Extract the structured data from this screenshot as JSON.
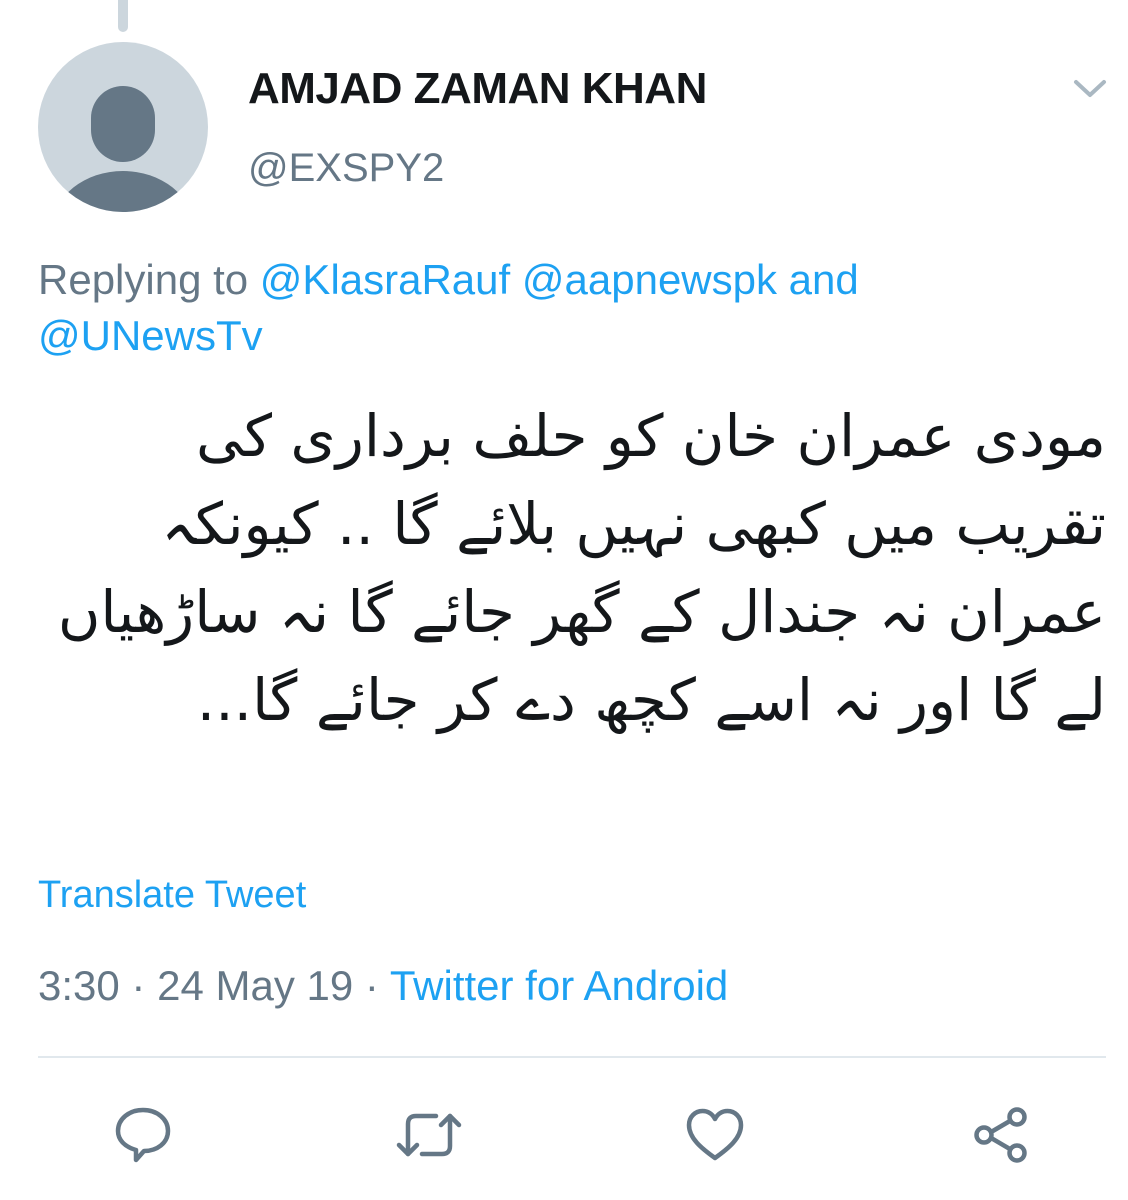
{
  "tweet": {
    "author": {
      "display_name": "AMJAD ZAMAN KHAN",
      "handle": "@EXSPY2",
      "avatar_icon": "default-avatar-icon"
    },
    "replying": {
      "prefix": "Replying to",
      "mentions": [
        "@KlasraRauf",
        "@aapnewspk"
      ],
      "conjunction": "and",
      "last_mention": "@UNewsTv"
    },
    "text": "مودی عمران خان کو حلف برداری کی تقریب میں کبھی نہیں بلائے گا .. کیونکہ عمران نہ جندال کے گھر جائے گا نہ ساڑھیاں لے گا اور نہ اسے کچھ دے کر جائے گا...",
    "translate_label": "Translate Tweet",
    "time": "3:30",
    "date": "24 May 19",
    "separator": "·",
    "source": "Twitter for Android"
  },
  "actions": [
    {
      "name": "reply",
      "icon": "reply-icon"
    },
    {
      "name": "retweet",
      "icon": "retweet-icon"
    },
    {
      "name": "like",
      "icon": "heart-icon"
    },
    {
      "name": "share",
      "icon": "share-icon"
    }
  ],
  "colors": {
    "link": "#1da1f2",
    "secondary_text": "#657786",
    "primary_text": "#14171a",
    "divider": "#e1e8ed",
    "avatar_bg": "#ccd6dd",
    "avatar_fg": "#657786"
  }
}
